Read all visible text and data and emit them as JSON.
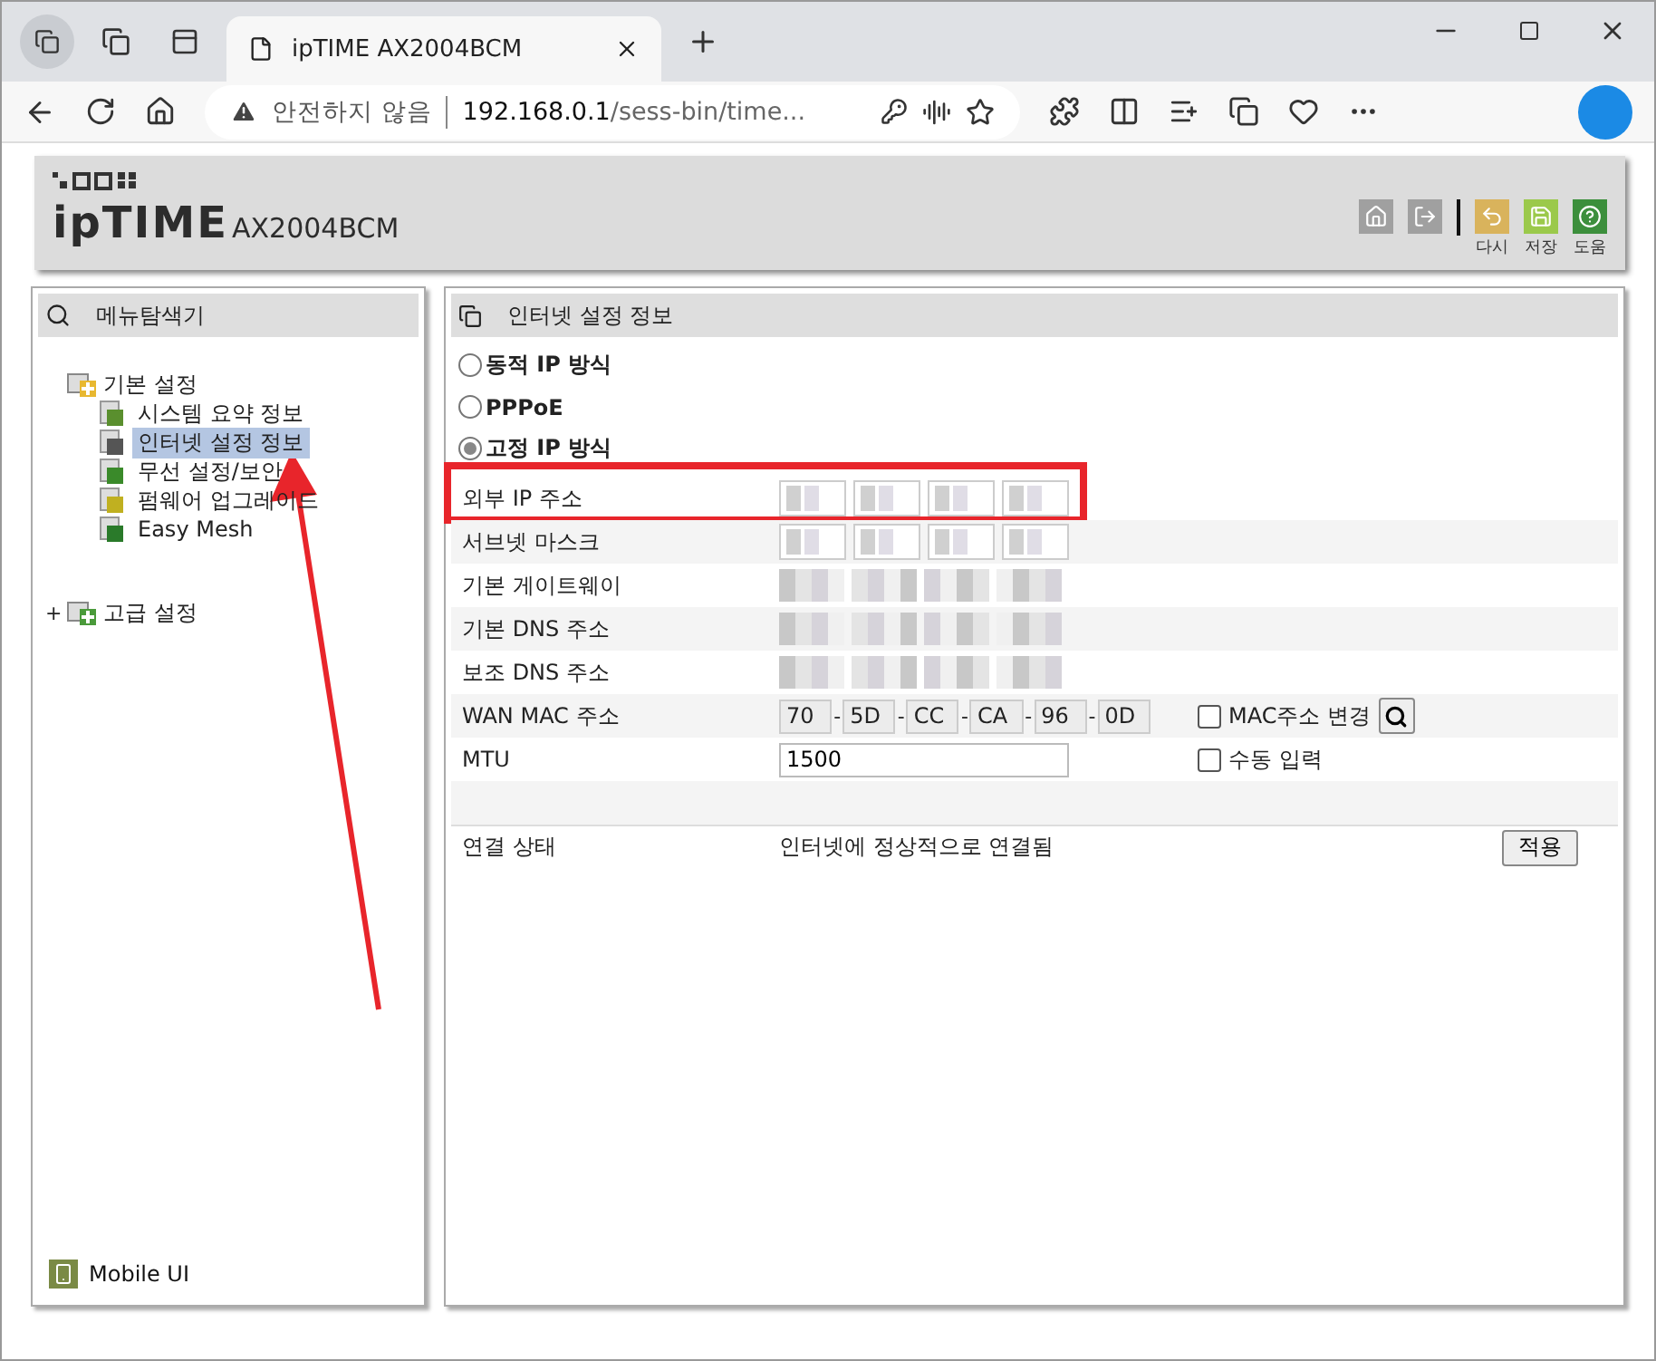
{
  "browser": {
    "tab_title": "ipTIME AX2004BCM",
    "warning": "안전하지 않음",
    "url_host": "192.168.0.1",
    "url_path": "/sess-bin/time..."
  },
  "router": {
    "logo": "ipTIME",
    "model": "AX2004BCM",
    "toolbar": [
      {
        "kind": "home"
      },
      {
        "kind": "logout"
      },
      {
        "kind": "undo",
        "label": "다시"
      },
      {
        "kind": "save",
        "label": "저장"
      },
      {
        "kind": "help",
        "label": "도움"
      }
    ]
  },
  "menu": {
    "title": "메뉴탐색기",
    "tree": [
      {
        "label": "기본 설정",
        "expanded": true,
        "children": [
          {
            "label": "시스템 요약 정보",
            "kind": "chart",
            "selected": false
          },
          {
            "label": "인터넷 설정 정보",
            "kind": "monitor",
            "selected": true
          },
          {
            "label": "무선 설정/보안",
            "kind": "wifi",
            "selected": false
          },
          {
            "label": "펌웨어 업그레이드",
            "kind": "upgrade",
            "selected": false
          },
          {
            "label": "Easy Mesh",
            "kind": "mesh",
            "selected": false
          }
        ]
      },
      {
        "label": "고급 설정",
        "expanded": false,
        "toggle": "+"
      }
    ],
    "mobile": "Mobile UI"
  },
  "panel": {
    "title": "인터넷 설정 정보",
    "modes": [
      {
        "label": "동적 IP 방식",
        "selected": false
      },
      {
        "label": "PPPoE",
        "selected": false
      },
      {
        "label": "고정 IP 방식",
        "selected": true
      }
    ],
    "rows": [
      {
        "kind": "redacted-fields",
        "label": "외부 IP 주소",
        "highlighted": true
      },
      {
        "kind": "redacted-fields",
        "label": "서브넷 마스크",
        "highlighted": false
      },
      {
        "kind": "redacted",
        "label": "기본 게이트웨이",
        "highlighted": false
      },
      {
        "kind": "redacted",
        "label": "기본 DNS 주소",
        "highlighted": false
      },
      {
        "kind": "redacted",
        "label": "보조 DNS 주소",
        "highlighted": false
      },
      {
        "kind": "mac",
        "label": "WAN MAC 주소",
        "octets": [
          "70",
          "5D",
          "CC",
          "CA",
          "96",
          "0D"
        ],
        "separator": "-",
        "option": {
          "label": "MAC주소 변경",
          "checked": false
        },
        "highlighted": false
      },
      {
        "kind": "input",
        "label": "MTU",
        "value": "1500",
        "option": {
          "label": "수동 입력",
          "checked": false
        },
        "highlighted": false
      },
      {
        "kind": "blank",
        "highlighted": false
      },
      {
        "kind": "status",
        "label": "연결 상태",
        "value": "인터넷에 정상적으로 연결됨",
        "button": "적용",
        "highlighted": false
      }
    ]
  },
  "annotations": [
    {
      "kind": "arrow"
    }
  ]
}
